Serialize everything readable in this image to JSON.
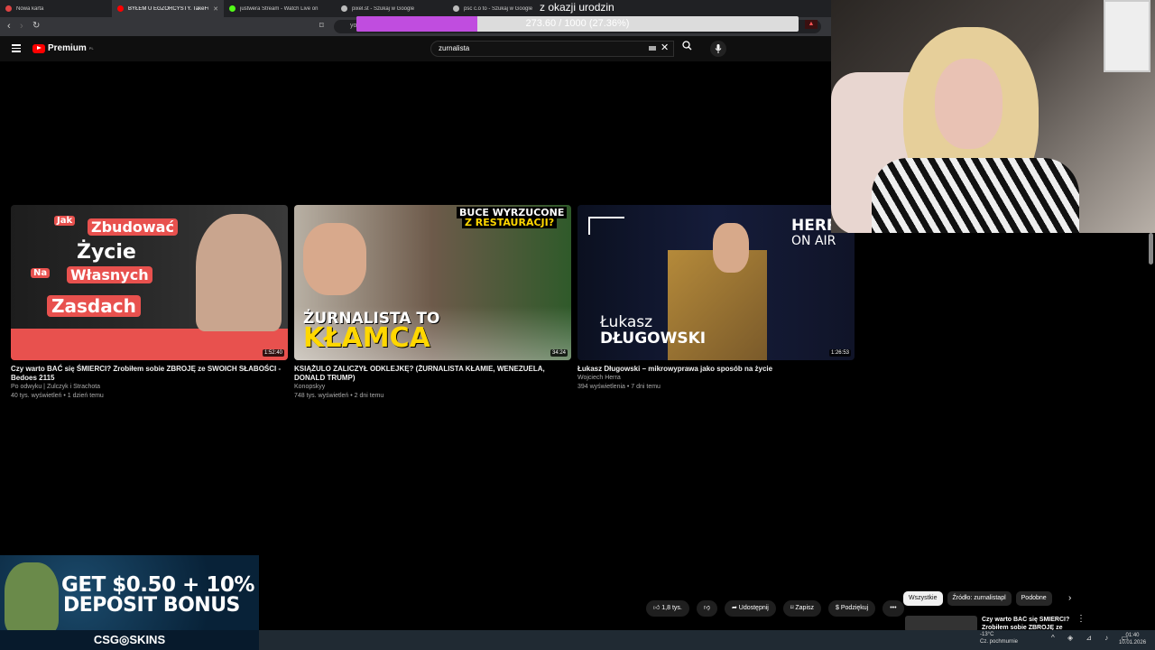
{
  "browser": {
    "tabs": [
      {
        "label": "Nowa karta",
        "color": "#d44"
      },
      {
        "label": "BYŁEM U EGZORCYSTY. TakeFu",
        "color": "#f00",
        "active": true
      },
      {
        "label": "justwera Stream - Watch Live on",
        "color": "#53fc18"
      },
      {
        "label": "pixel.st - Szukaj w Google",
        "color": "#bbb"
      },
      {
        "label": "psc c.o to - Szukaj w Google",
        "color": "#bbb"
      }
    ],
    "url": "yo"
  },
  "goal": {
    "title": "z okazji urodzin",
    "progress_text": "273.60 / 1000 (27.36%)",
    "progress": 0.2736
  },
  "youtube": {
    "logo": "Premium",
    "logo_sup": "PL",
    "search_value": "zurnalista"
  },
  "videos": [
    {
      "duration": "1:52:40",
      "title": "Czy warto BAĆ się ŚMIERCI? Zrobiłem sobie ZBROJĘ ze SWOICH SŁABOŚCI - Bedoes 2115",
      "channel": "Po odwyku | Zulczyk i Strachota",
      "meta": "40 tys. wyświetleń • 1 dzień temu",
      "thumb_words": [
        "Jak",
        "Zbudować",
        "Życie",
        "Na",
        "Własnych",
        "Zasdach"
      ]
    },
    {
      "duration": "34:24",
      "title": "KSIĄŻULO ZALICZYŁ ODKLEJKĘ? (ŻURNALISTA KŁAMIE, WENEZUELA, DONALD TRUMP)",
      "channel": "Konopskyy",
      "meta": "748 tys. wyświetleń • 2 dni temu",
      "thumb_words": [
        "BUCE WYRZUCONE",
        "Z RESTAURACJI?",
        "ŻURNALISTA TO",
        "KŁAMCA"
      ]
    },
    {
      "duration": "1:26:53",
      "title": "Łukasz Długowski – mikrowyprawa jako sposób na życie",
      "channel": "Wojciech Herra",
      "meta": "394 wyświetlenia • 7 dni temu",
      "thumb_words": [
        "HERRA",
        "ON AIR",
        "Łukasz",
        "DŁUGOWSKI"
      ]
    }
  ],
  "actions": {
    "like": "1,8 tys.",
    "share": "Udostępnij",
    "save": "Zapisz",
    "thanks": "Podziękuj"
  },
  "chips": [
    "Wszystkie",
    "Źródło: zurnalistapl",
    "Podobne"
  ],
  "recommendation": {
    "title": "Czy warto BAĆ się ŚMIERCI? Zrobiłem sobie ZBROJĘ ze"
  },
  "ad": {
    "line1": "GET $0.50 + 10%",
    "line2": "DEPOSIT BONUS",
    "brand": "CSG◎SKINS"
  },
  "taskbar": {
    "temp": "-13°C",
    "weather": "Cz. pochmurnie",
    "time": "01:40",
    "date": "10.01.2026"
  }
}
